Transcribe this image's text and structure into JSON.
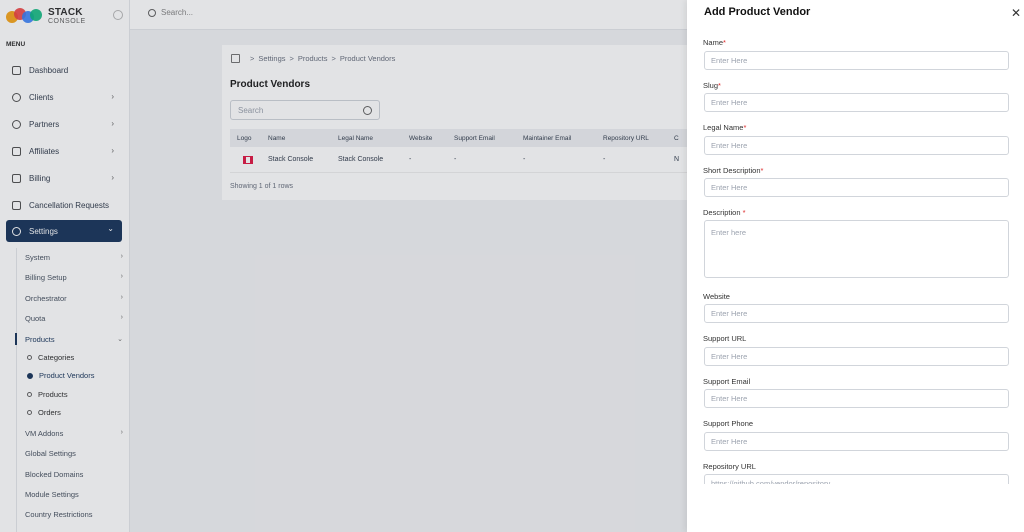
{
  "topbar": {
    "search_placeholder": "Search..."
  },
  "logo": {
    "line1": "STACK",
    "line2": "CONSOLE"
  },
  "sidebar": {
    "menu_label": "MENU",
    "items": [
      {
        "label": "Dashboard",
        "icon": "home-icon",
        "has_children": false
      },
      {
        "label": "Clients",
        "icon": "user-icon",
        "has_children": true
      },
      {
        "label": "Partners",
        "icon": "users-icon",
        "has_children": true
      },
      {
        "label": "Affiliates",
        "icon": "handshake-icon",
        "has_children": true
      },
      {
        "label": "Billing",
        "icon": "billing-icon",
        "has_children": true
      },
      {
        "label": "Cancellation Requests",
        "icon": "document-icon",
        "has_children": false
      },
      {
        "label": "Settings",
        "icon": "gear-icon",
        "has_children": true,
        "active": true
      }
    ],
    "sub_items": [
      {
        "label": "System",
        "has_children": true
      },
      {
        "label": "Billing Setup",
        "has_children": true
      },
      {
        "label": "Orchestrator",
        "has_children": true
      },
      {
        "label": "Quota",
        "has_children": true
      },
      {
        "label": "Products",
        "has_children": true,
        "expanded": true
      }
    ],
    "product_children": [
      {
        "label": "Categories"
      },
      {
        "label": "Product Vendors",
        "active": true
      },
      {
        "label": "Products"
      },
      {
        "label": "Orders"
      }
    ],
    "sub_items_after": [
      {
        "label": "VM Addons",
        "has_children": true
      },
      {
        "label": "Global Settings",
        "has_children": false
      },
      {
        "label": "Blocked Domains",
        "has_children": false
      },
      {
        "label": "Module Settings",
        "has_children": false
      },
      {
        "label": "Country Restrictions",
        "has_children": false
      }
    ]
  },
  "breadcrumb": {
    "items": [
      "Settings",
      "Products",
      "Product Vendors"
    ],
    "separator": ">"
  },
  "page": {
    "title": "Product Vendors",
    "search_placeholder": "Search",
    "showing_text": "Showing 1 of 1 rows"
  },
  "table": {
    "columns": [
      "Logo",
      "Name",
      "Legal Name",
      "Website",
      "Support Email",
      "Maintainer Email",
      "Repository URL",
      "C"
    ],
    "rows": [
      {
        "name": "Stack Console",
        "legal_name": "Stack Console",
        "website": "-",
        "support_email": "-",
        "maintainer_email": "-",
        "repository_url": "-",
        "extra": "N"
      }
    ]
  },
  "drawer": {
    "title": "Add Product Vendor",
    "close_glyph": "✕",
    "fields": [
      {
        "label": "Name",
        "required": true,
        "placeholder": "Enter Here"
      },
      {
        "label": "Slug",
        "required": true,
        "placeholder": "Enter Here"
      },
      {
        "label": "Legal Name",
        "required": true,
        "placeholder": "Enter Here"
      },
      {
        "label": "Short Description",
        "required": true,
        "placeholder": "Enter Here"
      },
      {
        "label": "Description",
        "required": true,
        "placeholder": "Enter here"
      },
      {
        "label": "Website",
        "required": false,
        "placeholder": "Enter Here"
      },
      {
        "label": "Support URL",
        "required": false,
        "placeholder": "Enter Here"
      },
      {
        "label": "Support Email",
        "required": false,
        "placeholder": "Enter Here"
      },
      {
        "label": "Support Phone",
        "required": false,
        "placeholder": "Enter Here"
      },
      {
        "label": "Repository URL",
        "required": false,
        "placeholder": "https://github.com/vendor/repository"
      }
    ]
  }
}
